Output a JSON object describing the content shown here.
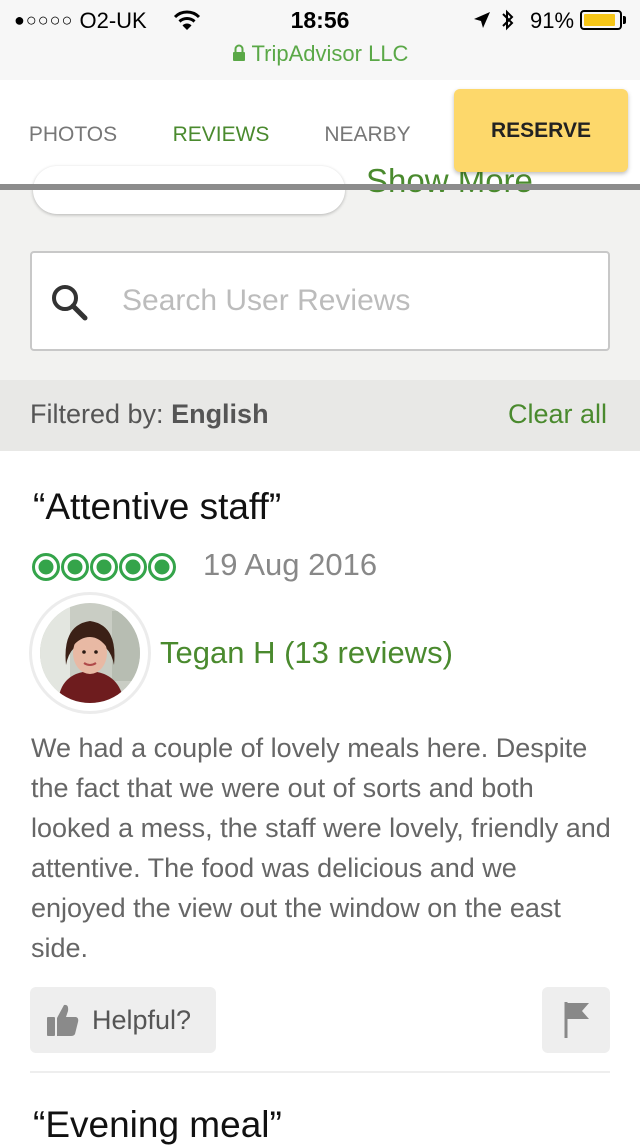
{
  "status_bar": {
    "carrier": "O2-UK",
    "signal_dots": "●○○○○",
    "time": "18:56",
    "battery_percent": "91%",
    "battery_level": 0.91,
    "site": "TripAdvisor LLC"
  },
  "tabs": [
    {
      "label": "PHOTOS",
      "active": false
    },
    {
      "label": "REVIEWS",
      "active": true
    },
    {
      "label": "NEARBY",
      "active": false
    }
  ],
  "reserve_label": "RESERVE",
  "show_more_partial": "Show More",
  "search": {
    "placeholder": "Search User Reviews",
    "value": ""
  },
  "filter": {
    "prefix": "Filtered by: ",
    "value": "English",
    "clear_label": "Clear all"
  },
  "review": {
    "title": "“Attentive staff”",
    "rating": 5,
    "rating_max": 5,
    "date": "19 Aug 2016",
    "reviewer": "Tegan H (13 reviews)",
    "body": "We had a couple of lovely meals here. Despite the fact that we were out of sorts and both looked a mess, the staff were lovely, friendly and attentive. The food was delicious and we enjoyed the view out the window on the east side.",
    "helpful_label": "Helpful?"
  },
  "next_review": {
    "title": "“Evening meal”"
  },
  "colors": {
    "accent": "#4a8a2e",
    "rating": "#34a44a",
    "reserve": "#fdd86b",
    "status_green": "#5aa847"
  },
  "icons": [
    "wifi-icon",
    "location-arrow-icon",
    "bluetooth-icon",
    "lock-icon",
    "search-icon",
    "thumbs-up-icon",
    "flag-icon"
  ]
}
